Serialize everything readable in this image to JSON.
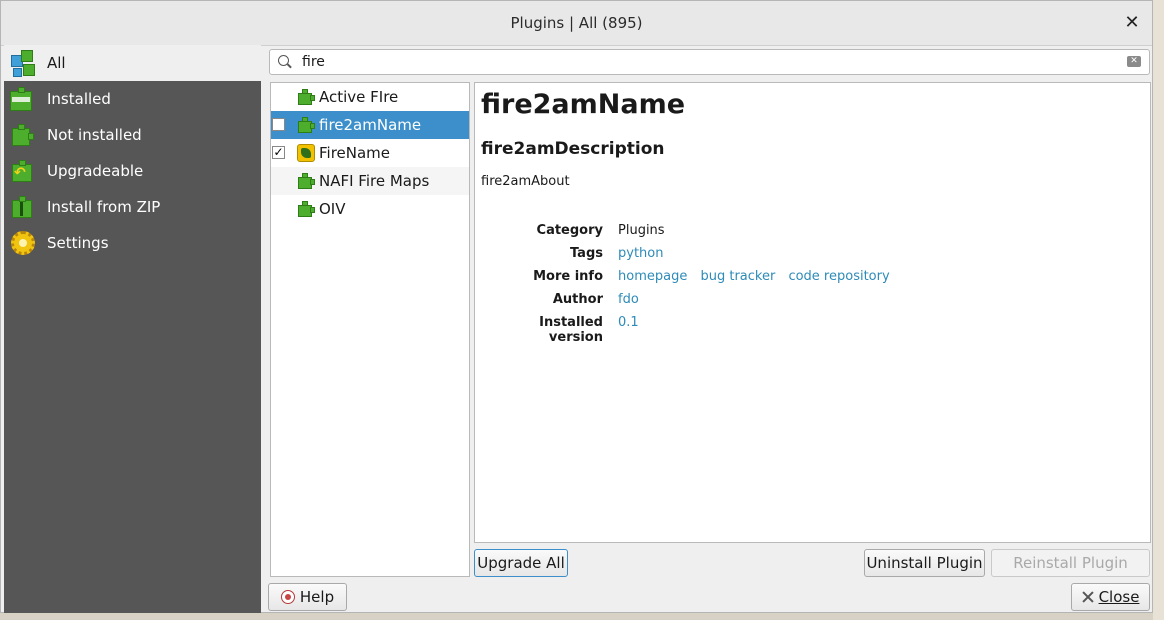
{
  "window": {
    "title": "Plugins | All (895)",
    "close_glyph": "✕"
  },
  "sidebar": {
    "items": [
      {
        "label": "All",
        "icon": "all-plugins-icon"
      },
      {
        "label": "Installed",
        "icon": "installed-plugins-icon"
      },
      {
        "label": "Not installed",
        "icon": "not-installed-plugins-icon"
      },
      {
        "label": "Upgradeable",
        "icon": "upgradeable-plugins-icon"
      },
      {
        "label": "Install from ZIP",
        "icon": "install-zip-icon"
      },
      {
        "label": "Settings",
        "icon": "settings-gear-icon"
      }
    ]
  },
  "search": {
    "value": "fire",
    "clear_glyph": "✕"
  },
  "plugin_list": [
    {
      "name": "Active FIre",
      "checkbox": "none"
    },
    {
      "name": "fire2amName",
      "checkbox": "unchecked"
    },
    {
      "name": "FireName",
      "checkbox": "checked"
    },
    {
      "name": "NAFI Fire Maps",
      "checkbox": "none"
    },
    {
      "name": "OIV",
      "checkbox": "none"
    }
  ],
  "checkmark": "✓",
  "details": {
    "title": "fire2amName",
    "description": "fire2amDescription",
    "about": "fire2amAbout",
    "labels": {
      "category": "Category",
      "tags": "Tags",
      "more_info": "More info",
      "author": "Author",
      "installed_version": "Installed version"
    },
    "category": "Plugins",
    "tags": "python",
    "links": {
      "homepage": "homepage",
      "bug_tracker": "bug tracker",
      "code_repository": "code repository"
    },
    "author": "fdo",
    "installed_version": "0.1"
  },
  "buttons": {
    "upgrade_all": "Upgrade All",
    "uninstall": "Uninstall Plugin",
    "reinstall": "Reinstall Plugin",
    "help": "Help",
    "close": "Close"
  },
  "colors": {
    "sidebar_bg": "#565656",
    "selection": "#3c8fca",
    "link": "#2e8bb8",
    "puzzle_green": "#4cae2c"
  }
}
